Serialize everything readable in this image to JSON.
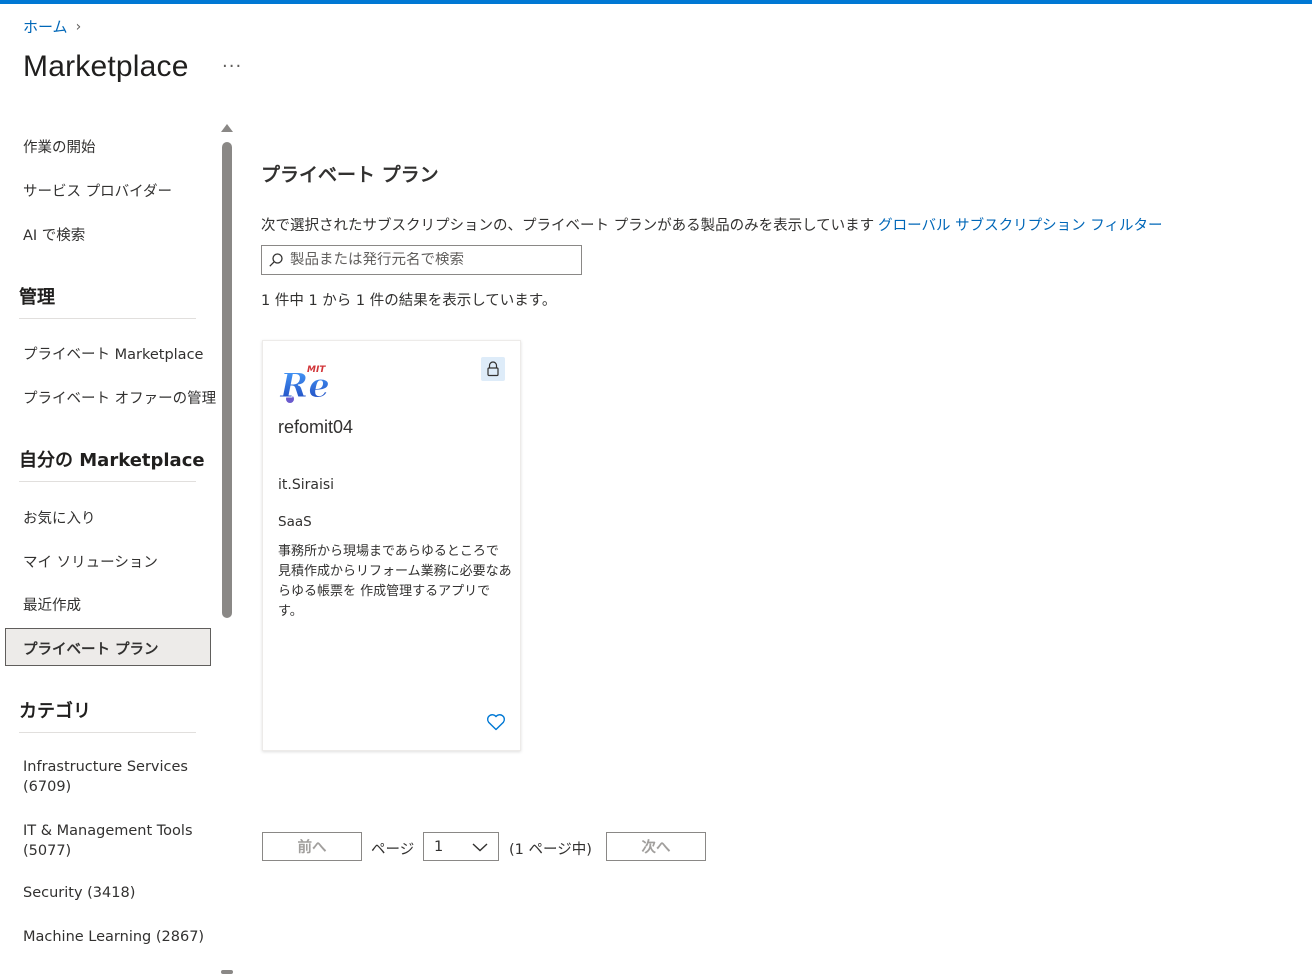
{
  "breadcrumb": {
    "home": "ホーム"
  },
  "page": {
    "title": "Marketplace",
    "more": "···"
  },
  "sidebar": {
    "start": "作業の開始",
    "providers": "サービス プロバイダー",
    "ai_search": "AI で検索",
    "manage_header": "管理",
    "private_marketplace": "プライベート Marketplace",
    "private_offer_mgmt": "プライベート オファーの管理",
    "my_marketplace_header": "自分の Marketplace",
    "favorites": "お気に入り",
    "my_solutions": "マイ ソリューション",
    "recent": "最近作成",
    "private_plans": "プライベート プラン",
    "category_header": "カテゴリ",
    "categories": [
      "Infrastructure Services (6709)",
      "IT & Management Tools (5077)",
      "Security (3418)",
      "Machine Learning (2867)"
    ]
  },
  "main": {
    "title": "プライベート プラン",
    "info_text": "次で選択されたサブスクリプションの、プライベート プランがある製品のみを表示しています",
    "filter_link": "グローバル サブスクリプション フィルター",
    "search_placeholder": "製品または発行元名で検索",
    "results": "1 件中 1 から 1 件の結果を表示しています。"
  },
  "card": {
    "name": "refomit04",
    "publisher": "it.Siraisi",
    "type": "SaaS",
    "description": "事務所から現場まであらゆるところで 見積作成からリフォーム業務に必要なあらゆる帳票を 作成管理するアプリです。",
    "logo_text": "Re",
    "logo_sup": "MIT"
  },
  "pagination": {
    "prev": "前へ",
    "page_label": "ページ",
    "current": "1",
    "of_pages": "(1 ページ中)",
    "next": "次へ"
  },
  "colors": {
    "accent": "#0078d4",
    "link": "#0067b8",
    "selected_bg": "#edebe9"
  }
}
